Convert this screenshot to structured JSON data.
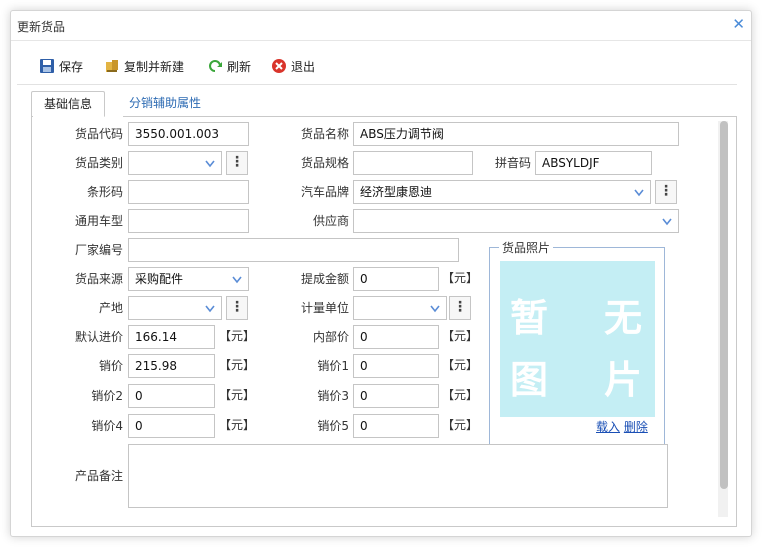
{
  "window": {
    "title": "更新货品"
  },
  "toolbar": {
    "save": "保存",
    "copy_new": "复制并新建",
    "refresh": "刷新",
    "exit": "退出"
  },
  "tabs": [
    {
      "label": "基础信息"
    },
    {
      "label": "分销辅助属性"
    }
  ],
  "form": {
    "code_label": "货品代码",
    "code_value": "3550.001.003",
    "name_label": "货品名称",
    "name_value": "ABS压力调节阀",
    "category_label": "货品类别",
    "category_value": "",
    "spec_label": "货品规格",
    "spec_value": "",
    "pinyin_label": "拼音码",
    "pinyin_value": "ABSYLDJF",
    "barcode_label": "条形码",
    "barcode_value": "",
    "brand_label": "汽车品牌",
    "brand_value": "经济型康恩迪",
    "model_label": "通用车型",
    "model_value": "",
    "supplier_label": "供应商",
    "supplier_value": "",
    "mfr_label": "厂家编号",
    "mfr_value": "",
    "source_label": "货品来源",
    "source_value": "采购配件",
    "commission_label": "提成金额",
    "commission_value": "0",
    "origin_label": "产地",
    "origin_value": "",
    "unit_label": "计量单位",
    "unit_value": "",
    "cost_label": "默认进价",
    "cost_value": "166.14",
    "internal_label": "内部价",
    "internal_value": "0",
    "price_label": "销价",
    "price_value": "215.98",
    "price1_label": "销价1",
    "price1_value": "0",
    "price2_label": "销价2",
    "price2_value": "0",
    "price3_label": "销价3",
    "price3_value": "0",
    "price4_label": "销价4",
    "price4_value": "0",
    "price5_label": "销价5",
    "price5_value": "0",
    "notes_label": "产品备注",
    "notes_value": "",
    "yuan": "【元】",
    "more_glyph": "⋮"
  },
  "photo": {
    "legend": "货品照片",
    "char1": "暂",
    "char2": "无",
    "char3": "图",
    "char4": "片",
    "load": "载入",
    "delete": "删除"
  },
  "colors": {
    "accent": "#2d6bb3",
    "photo_bg": "#c4eef4",
    "close": "#4a8bd8"
  }
}
